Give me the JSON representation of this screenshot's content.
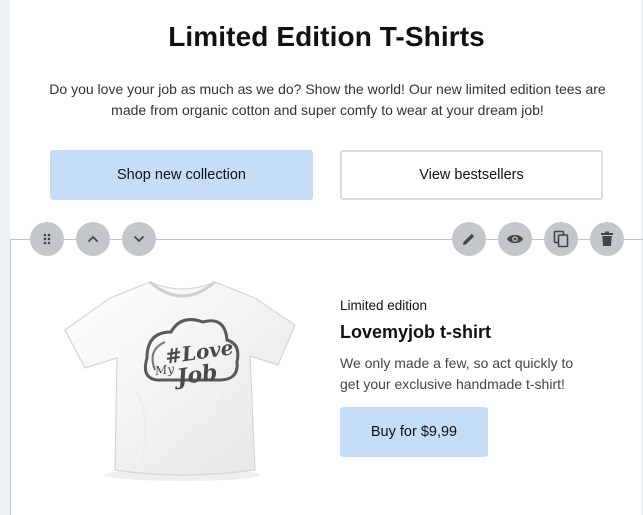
{
  "hero": {
    "title": "Limited Edition T-Shirts",
    "text": "Do you love your job as much as we do? Show the world! Our new limited edition tees are made from organic cotton and super comfy to wear at your dream job!",
    "primary_button": "Shop new collection",
    "secondary_button": "View bestsellers"
  },
  "toolbar": {
    "left_icons": [
      "drag-handle-icon",
      "chevron-up-icon",
      "chevron-down-icon"
    ],
    "right_icons": [
      "pencil-icon",
      "eye-icon",
      "copy-icon",
      "trash-icon"
    ]
  },
  "product": {
    "kicker": "Limited edition",
    "title": "Lovemyjob t-shirt",
    "description": "We only made a few, so act quickly to get your exclusive handmade t-shirt!",
    "buy_button": "Buy for $9,99",
    "shirt_print_top": "#Love",
    "shirt_print_mid": "My",
    "shirt_print_bottom": "Job"
  },
  "colors": {
    "primary_button_bg": "#c6ddf8",
    "tool_button_bg": "#c4c7ca",
    "divider": "#bfc4c8"
  }
}
